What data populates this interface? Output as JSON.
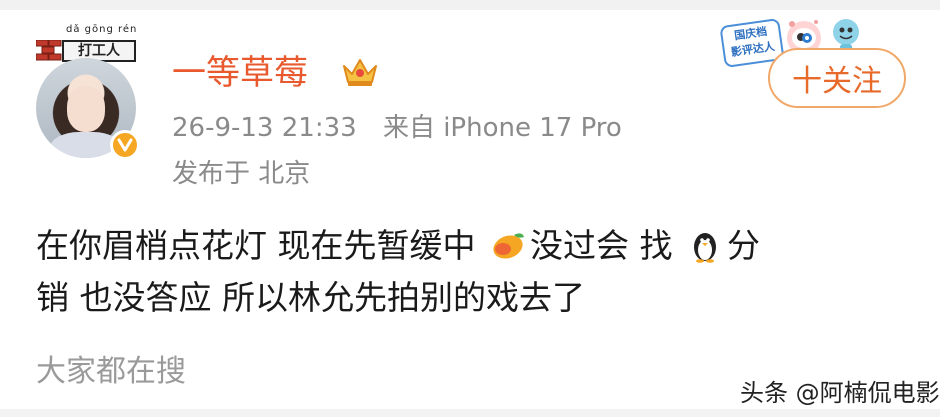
{
  "sign": {
    "pinyin": "dǎ gōng rén",
    "text": "打工人"
  },
  "user": {
    "name": "一等草莓",
    "time": "26-9-13 21:33",
    "source": "来自 iPhone 17 Pro",
    "location": "发布于 北京"
  },
  "badges": {
    "activity_badge": "国庆档\n影评达人"
  },
  "follow_button": "十关注",
  "post": {
    "line1_a": "在你眉梢点花灯 现在先暂缓中",
    "line1_b": "没过会 找",
    "line1_c": "分",
    "line2": "销 也没答应 所以林允先拍别的戏去了"
  },
  "trending_label": "大家都在搜",
  "watermark": "头条 @阿楠侃电影",
  "colors": {
    "username": "#e8592e",
    "verified": "#f5a623",
    "follow_border": "#f0a96a",
    "follow_text": "#e86a2a",
    "meta": "#8a8a8a"
  },
  "icons": [
    "verified-icon",
    "crown-icon",
    "mango-emoji-icon",
    "penguin-emoji-icon"
  ]
}
